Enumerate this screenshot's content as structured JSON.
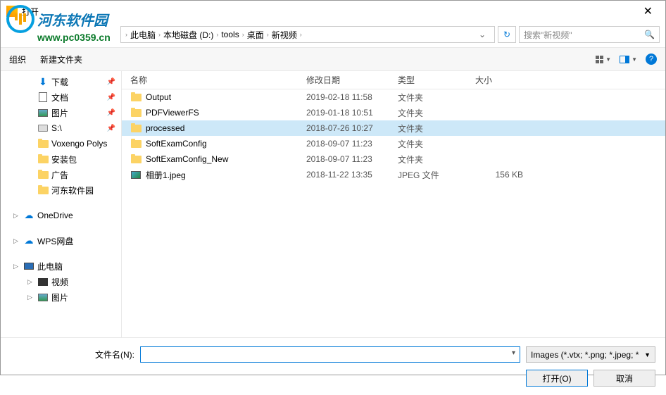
{
  "window": {
    "title": "打开"
  },
  "watermark": {
    "name": "河东软件园",
    "url": "www.pc0359.cn"
  },
  "breadcrumb": {
    "items": [
      "此电脑",
      "本地磁盘 (D:)",
      "tools",
      "桌面",
      "新视频"
    ]
  },
  "search": {
    "placeholder": "搜索\"新视频\""
  },
  "toolbar": {
    "organize": "组织",
    "newfolder": "新建文件夹"
  },
  "headers": {
    "name": "名称",
    "date": "修改日期",
    "type": "类型",
    "size": "大小"
  },
  "sidebar": {
    "items": [
      {
        "label": "下载",
        "icon": "download",
        "pinned": true,
        "indent": true
      },
      {
        "label": "文档",
        "icon": "document",
        "pinned": true,
        "indent": true
      },
      {
        "label": "图片",
        "icon": "picture",
        "pinned": true,
        "indent": true
      },
      {
        "label": "S:\\",
        "icon": "drive",
        "pinned": true,
        "indent": true
      },
      {
        "label": "Voxengo Polys",
        "icon": "folder",
        "indent": true
      },
      {
        "label": "安装包",
        "icon": "folder",
        "indent": true
      },
      {
        "label": "广告",
        "icon": "folder",
        "indent": true
      },
      {
        "label": "河东软件园",
        "icon": "folder",
        "indent": true
      },
      {
        "label": "",
        "icon": "",
        "blank": true
      },
      {
        "label": "OneDrive",
        "icon": "cloud",
        "caret": true
      },
      {
        "label": "",
        "icon": "",
        "blank": true
      },
      {
        "label": "WPS网盘",
        "icon": "wps",
        "caret": true
      },
      {
        "label": "",
        "icon": "",
        "blank": true
      },
      {
        "label": "此电脑",
        "icon": "pc",
        "caret": true
      },
      {
        "label": "视频",
        "icon": "video",
        "caret": true,
        "indent": true
      },
      {
        "label": "图片",
        "icon": "picture",
        "caret": true,
        "indent": true
      }
    ]
  },
  "files": [
    {
      "name": "Output",
      "date": "2019-02-18 11:58",
      "type": "文件夹",
      "size": "",
      "icon": "folder"
    },
    {
      "name": "PDFViewerFS",
      "date": "2019-01-18 10:51",
      "type": "文件夹",
      "size": "",
      "icon": "folder"
    },
    {
      "name": "processed",
      "date": "2018-07-26 10:27",
      "type": "文件夹",
      "size": "",
      "icon": "folder",
      "selected": true
    },
    {
      "name": "SoftExamConfig",
      "date": "2018-09-07 11:23",
      "type": "文件夹",
      "size": "",
      "icon": "folder"
    },
    {
      "name": "SoftExamConfig_New",
      "date": "2018-09-07 11:23",
      "type": "文件夹",
      "size": "",
      "icon": "folder"
    },
    {
      "name": "相册1.jpeg",
      "date": "2018-11-22 13:35",
      "type": "JPEG 文件",
      "size": "156 KB",
      "icon": "image"
    }
  ],
  "footer": {
    "filename_label": "文件名(N):",
    "filename_value": "",
    "filter": "Images (*.vtx; *.png; *.jpeg; *",
    "open": "打开(O)",
    "cancel": "取消"
  }
}
